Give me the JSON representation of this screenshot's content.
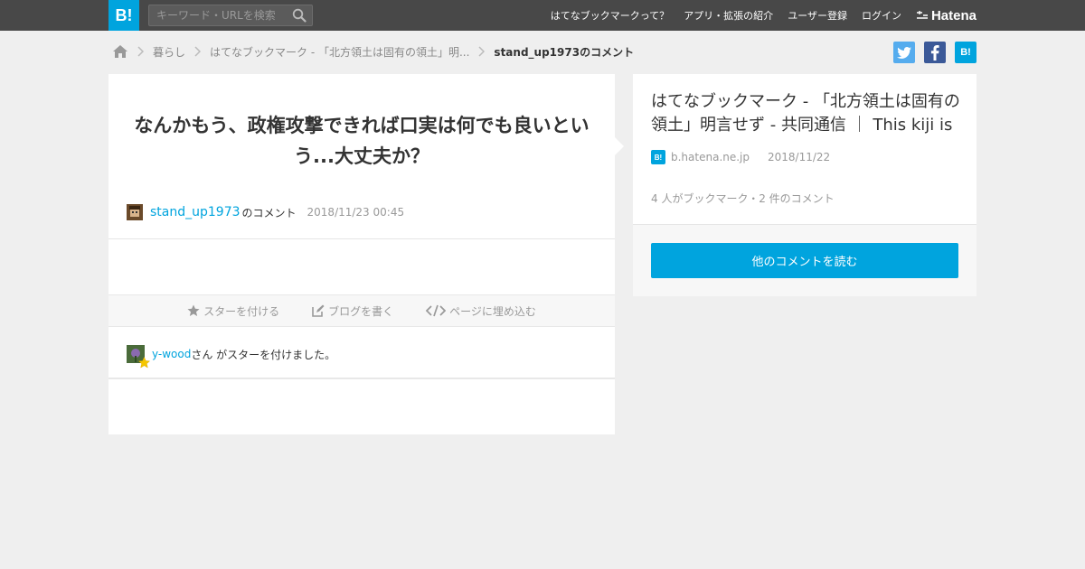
{
  "header": {
    "logo": "B!",
    "search_placeholder": "キーワード・URLを検索",
    "nav": [
      "はてなブックマークって？",
      "アプリ・拡張の紹介",
      "ユーザー登録",
      "ログイン"
    ],
    "hatena": "Hatena"
  },
  "breadcrumb": {
    "category": "暮らし",
    "entry": "はてなブックマーク - 「北方領土は固有の領土」明...",
    "current": "stand_up1973のコメント"
  },
  "share": {
    "hatena": "B!"
  },
  "comment": {
    "text": "なんかもう、政権攻撃できれば口実は何でも良いという...大丈夫か？",
    "user": "stand_up1973",
    "suffix": "のコメント",
    "date": "2018/11/23 00:45"
  },
  "actions": {
    "star": "スターを付ける",
    "blog": "ブログを書く",
    "embed": "ページに埋め込む"
  },
  "star_notice": {
    "user": "y-wood",
    "text": "さん がスターを付けました。"
  },
  "entry": {
    "title": "はてなブックマーク - 「北方領土は固有の領土」明言せず - 共同通信 ｜ This kiji is",
    "favicon": "B!",
    "domain": "b.hatena.ne.jp",
    "date": "2018/11/22",
    "stats": "4 人がブックマーク・2 件のコメント",
    "button": "他のコメントを読む"
  },
  "colors": {
    "accent": "#00a4de",
    "topbar": "#484848",
    "twitter": "#55acee",
    "facebook": "#3b5998"
  }
}
